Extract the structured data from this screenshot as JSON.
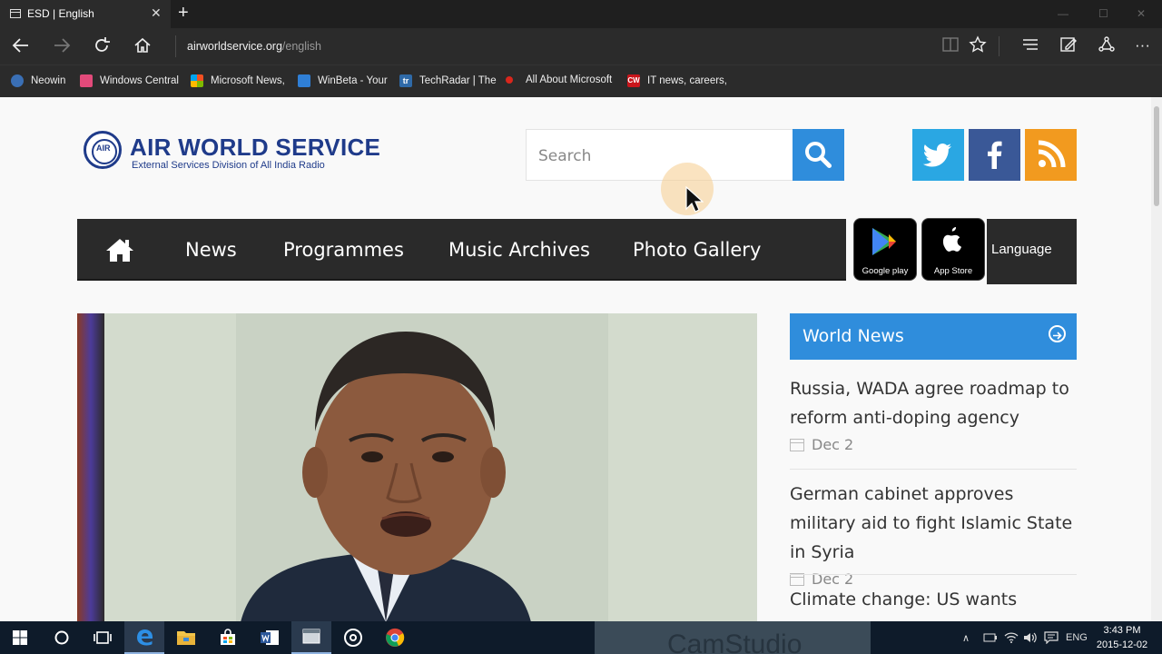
{
  "browser": {
    "tab_title": "ESD | English",
    "tab_close": "✕",
    "new_tab": "+",
    "address_host": "airworldservice.org",
    "address_path": "/english",
    "favorites": [
      {
        "label": "Neowin",
        "color": "#3a6fb5"
      },
      {
        "label": "Windows Central",
        "color": "#e24a7a"
      },
      {
        "label": "Microsoft News,",
        "color": "#f25022"
      },
      {
        "label": "WinBeta - Your",
        "color": "#2f7fd6"
      },
      {
        "label": "TechRadar | The",
        "color": "#2f6aa8"
      },
      {
        "label": "All About Microsoft",
        "color": "#d9261c"
      },
      {
        "label": "IT news, careers,",
        "color": "#c9151b"
      }
    ],
    "favicon_letters": {
      "techradar": "tr",
      "computerworld": "CW"
    }
  },
  "site": {
    "logo_title": "AIR WORLD SERVICE",
    "logo_subtitle": "External Services Division of All India Radio",
    "logo_emblem_text": "AIR",
    "search_placeholder": "Search",
    "menu": [
      "News",
      "Programmes",
      "Music Archives",
      "Photo Gallery"
    ],
    "google_play_label": "Google play",
    "app_store_label": "App Store",
    "language_label": "Language",
    "world_news_title": "World News",
    "news": [
      {
        "headline": "Russia, WADA agree roadmap to reform anti-doping agency",
        "date": "Dec 2"
      },
      {
        "headline": "German cabinet approves military aid to fight Islamic State in Syria",
        "date": "Dec 2"
      },
      {
        "headline": "Climate change: US wants China,",
        "date": ""
      }
    ]
  },
  "taskbar": {
    "language": "ENG",
    "time": "3:43 PM",
    "date": "2015-12-02",
    "ghost_app": "CamStudio"
  },
  "colors": {
    "brand_blue": "#1f3b8a",
    "accent_blue": "#2f8ddc",
    "twitter": "#2aa7e3",
    "facebook": "#3a5897",
    "rss": "#f29a1f"
  }
}
